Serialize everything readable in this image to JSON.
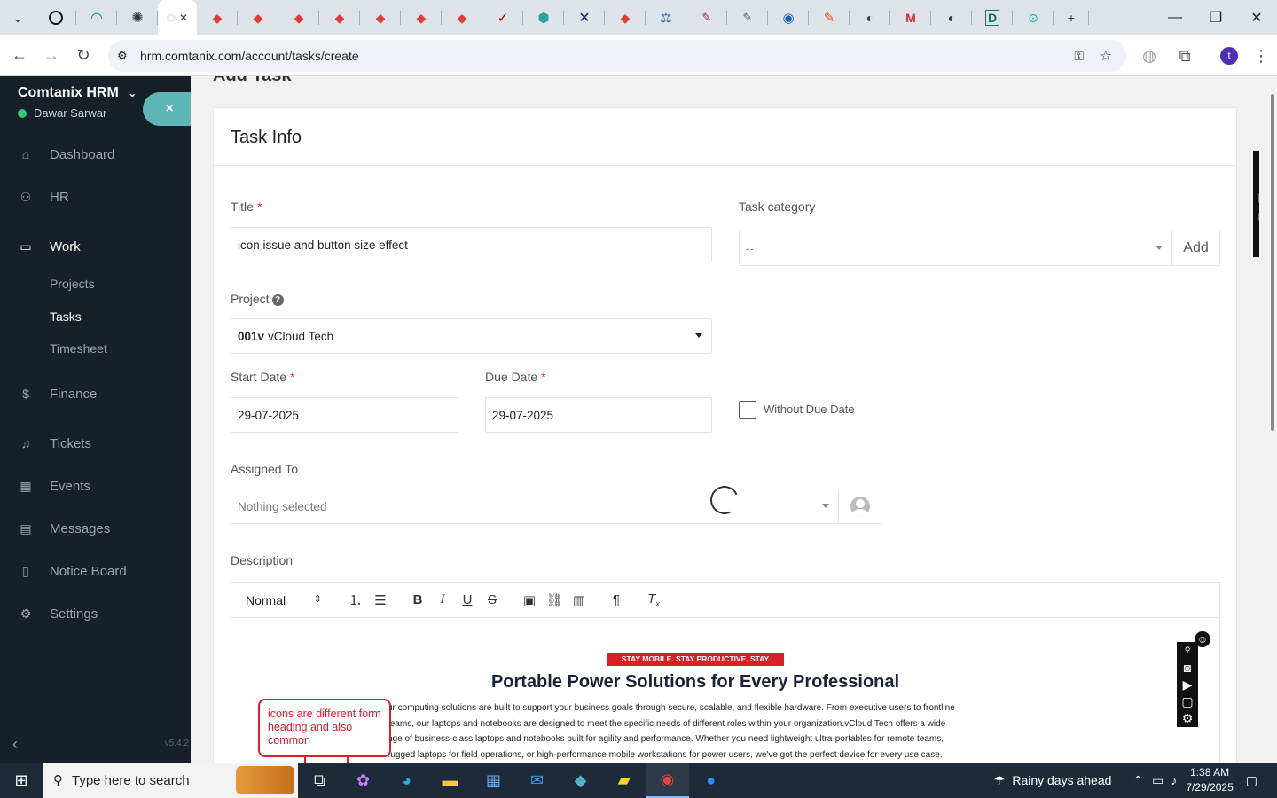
{
  "browser": {
    "tab_icons": [
      "chrome-dev-icon",
      "wifi-icon",
      "openai-icon",
      "active-tab",
      "gift-icon",
      "gift-icon",
      "gift-icon",
      "gift-icon",
      "gift-icon",
      "gift-icon",
      "gift-icon",
      "gift-icon",
      "check-icon",
      "puzzle-icon",
      "x-icon",
      "gift-icon",
      "scale-icon",
      "pen-icon",
      "pen-icon",
      "pulse-icon",
      "pen-icon",
      "globe-icon",
      "gmail-icon",
      "globe-icon",
      "d-icon",
      "search-icon"
    ],
    "active_tab_close": "✕",
    "new_tab": "+",
    "url": "hrm.comtanix.com/account/tasks/create",
    "profile_initial": "t",
    "colors": {
      "accent": "#4b2fb5",
      "tab_bar": "#dee3ea"
    }
  },
  "sidebar": {
    "brand": "Comtanix HRM",
    "user": "Dawar Sarwar",
    "close_symbol": "×",
    "items": [
      {
        "label": "Dashboard",
        "icon": "home-icon"
      },
      {
        "label": "HR",
        "icon": "users-icon"
      },
      {
        "label": "Work",
        "icon": "briefcase-icon"
      },
      {
        "label": "Finance",
        "icon": "dollar-icon"
      },
      {
        "label": "Tickets",
        "icon": "headset-icon"
      },
      {
        "label": "Events",
        "icon": "calendar-icon"
      },
      {
        "label": "Messages",
        "icon": "message-icon"
      },
      {
        "label": "Notice Board",
        "icon": "clipboard-icon"
      },
      {
        "label": "Settings",
        "icon": "gear-icon"
      }
    ],
    "work_subitems": [
      "Projects",
      "Tasks",
      "Timesheet"
    ],
    "version": "v5.4.2",
    "colors": {
      "background": "#171f29",
      "status_online": "#2ecc71",
      "toggle": "#5fb6b6"
    }
  },
  "page": {
    "title": "Add Task",
    "card_title": "Task Info",
    "title_label": "Title",
    "title_value": "icon issue and button size effect",
    "task_category_label": "Task category",
    "task_category_value": "--",
    "add_button": "Add",
    "project_label": "Project",
    "project_code": "001v",
    "project_name": "vCloud Tech",
    "start_date_label": "Start Date",
    "start_date_value": "29-07-2025",
    "due_date_label": "Due Date",
    "due_date_value": "29-07-2025",
    "without_due_date": "Without Due Date",
    "assigned_to_label": "Assigned To",
    "assigned_to_value": "Nothing selected",
    "description_label": "Description",
    "editor": {
      "format_select": "Normal",
      "tools": [
        "ordered-list-icon",
        "bullet-list-icon",
        "bold-icon",
        "italic-icon",
        "underline-icon",
        "strike-icon",
        "image-icon",
        "link-icon",
        "video-icon",
        "direction-icon",
        "clear-format-icon"
      ]
    },
    "embedded_image": {
      "ribbon": "STAY MOBILE. STAY PRODUCTIVE. STAY AHEAD.",
      "headline": "Portable Power Solutions for Every Professional",
      "paragraph_lines": [
        "ur computing solutions are built to support your business goals through secure, scalable, and flexible hardware. From executive users to frontline",
        "teams, our laptops and notebooks are designed to meet the specific needs of different roles within your organization.vCloud Tech offers a wide",
        "nge of business-class laptops and notebooks built for agility and performance. Whether you need lightweight ultra-portables for remote teams,",
        "rugged laptops for field operations, or high-performance mobile workstations for power users, we've got the perfect device for every use case."
      ],
      "annotation": "icons are different form heading and also common"
    },
    "colors": {
      "required": "#d9363e",
      "annotation": "#d81f2a"
    }
  },
  "taskbar": {
    "search_placeholder": "Type here to search",
    "weather": "Rainy days ahead",
    "time": "1:38 AM",
    "date": "7/29/2025",
    "apps": [
      "task-view-icon",
      "copilot-icon",
      "edge-icon",
      "file-explorer-icon",
      "store-icon",
      "mail-icon",
      "app-icon",
      "sticky-notes-icon",
      "chrome-icon",
      "zoom-icon"
    ]
  }
}
